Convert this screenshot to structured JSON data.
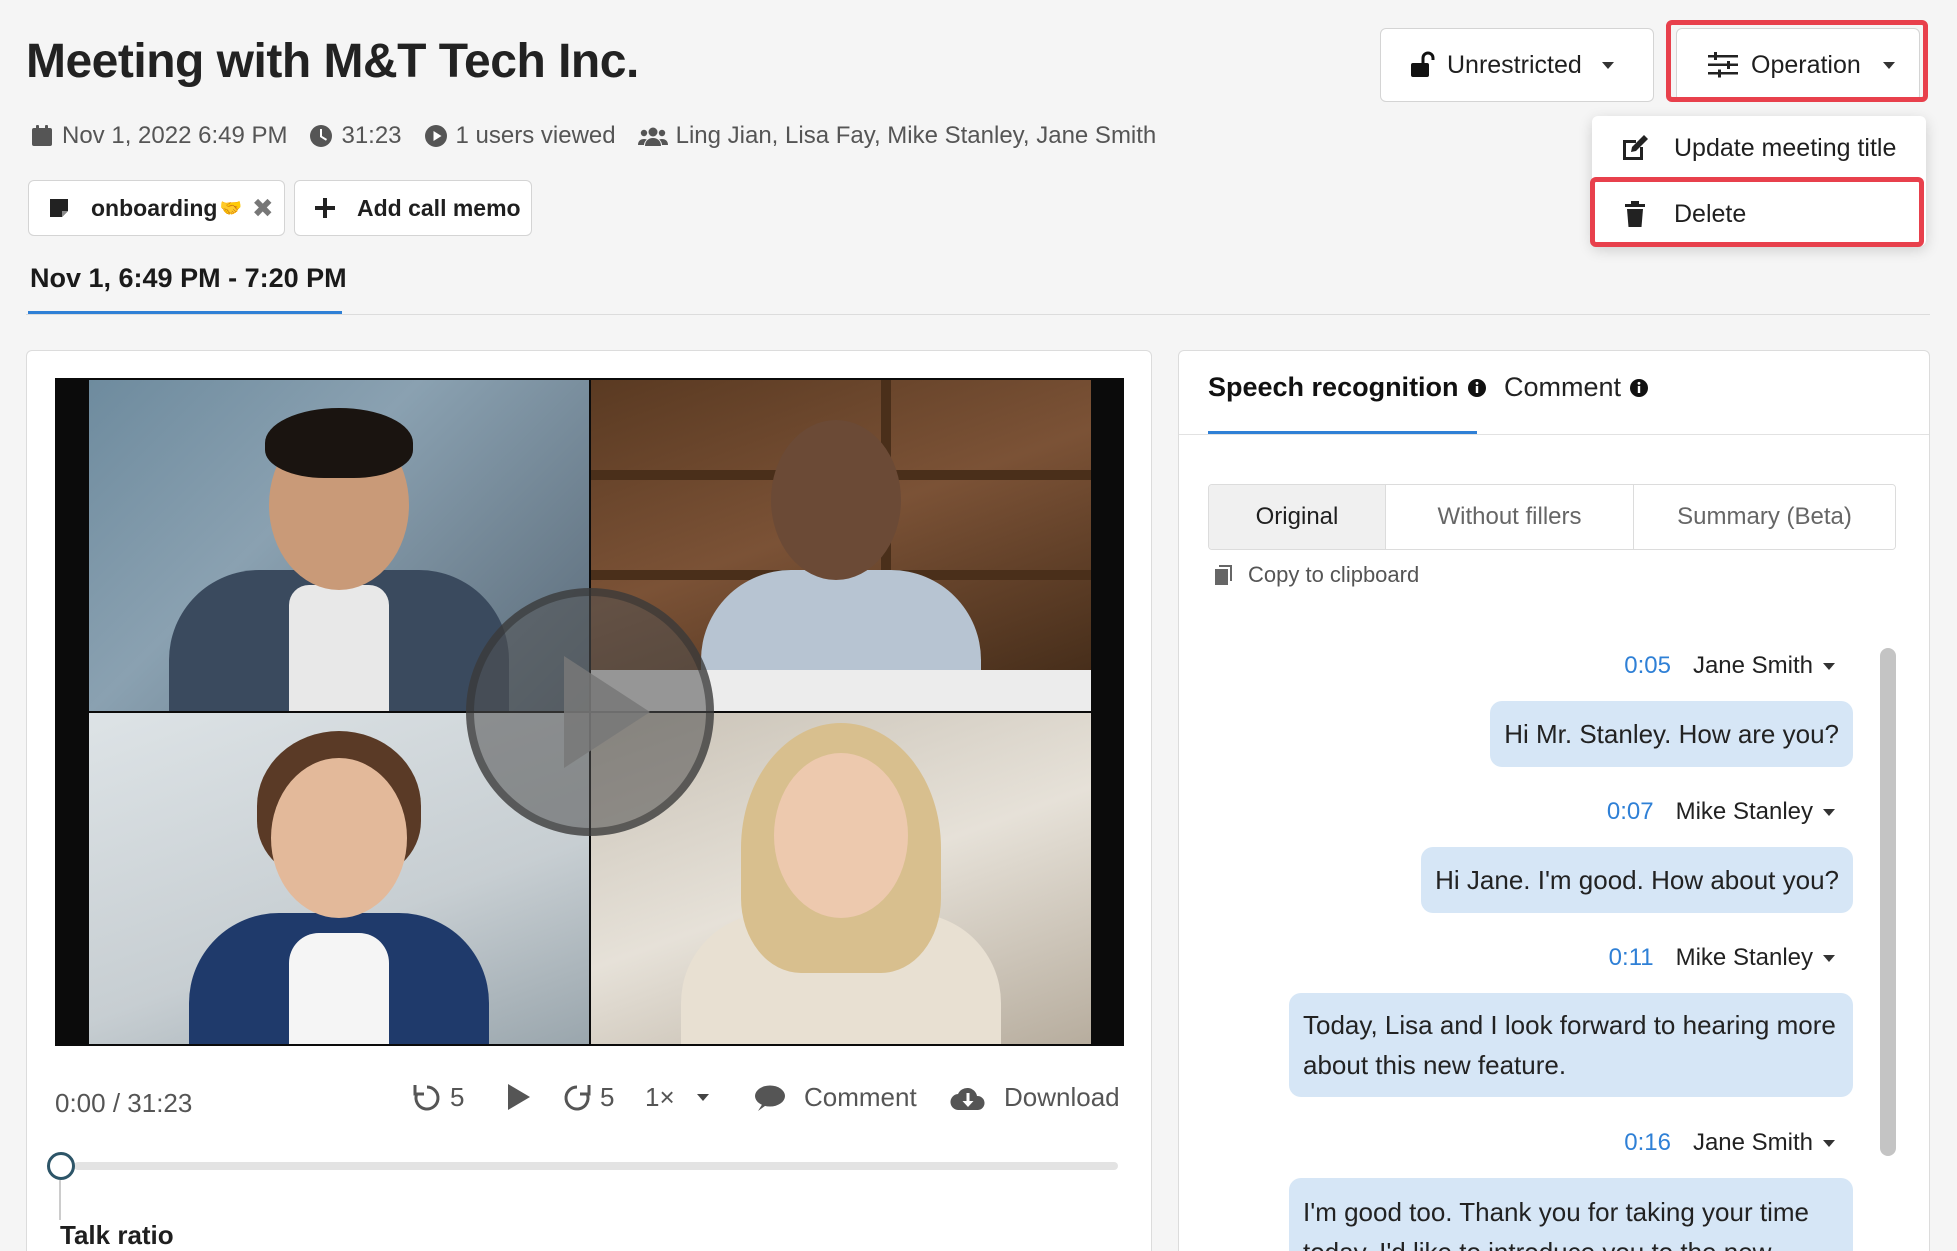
{
  "header": {
    "title": "Meeting with M&T Tech Inc.",
    "date": "Nov 1, 2022 6:49 PM",
    "duration": "31:23",
    "views": "1 users viewed",
    "participants": "Ling Jian, Lisa Fay, Mike Stanley, Jane Smith"
  },
  "tags": {
    "tag_label": "onboarding",
    "tag_emoji": "🤝",
    "remove_symbol": "✖",
    "add_memo_label": "Add call memo"
  },
  "session_range": "Nov 1, 6:49 PM - 7:20 PM",
  "toolbar": {
    "visibility_label": "Unrestricted",
    "operation_label": "Operation"
  },
  "operation_menu": {
    "items": [
      {
        "label": "Update meeting title",
        "icon": "edit-icon"
      },
      {
        "label": "Delete",
        "icon": "trash-icon"
      }
    ]
  },
  "player": {
    "time_display": "0:00 / 31:23",
    "rewind_seconds": "5",
    "forward_seconds": "5",
    "speed": "1×",
    "comment_label": "Comment",
    "download_label": "Download",
    "progress": 0
  },
  "talk_ratio_label": "Talk ratio",
  "transcript": {
    "tabs": [
      "Speech recognition",
      "Comment"
    ],
    "views": [
      "Original",
      "Without fillers",
      "Summary (Beta)"
    ],
    "selected_view": "Original",
    "copy_label": "Copy to clipboard",
    "messages": [
      {
        "time": "0:05",
        "speaker": "Jane Smith",
        "text": "Hi Mr. Stanley. How are you?"
      },
      {
        "time": "0:07",
        "speaker": "Mike Stanley",
        "text": "Hi Jane. I'm good. How about you?"
      },
      {
        "time": "0:11",
        "speaker": "Mike Stanley",
        "text": "Today, Lisa and I look forward to hearing more about this new feature."
      },
      {
        "time": "0:16",
        "speaker": "Jane Smith",
        "text": "I'm good too. Thank you for taking your time today. I'd like to introduce you to the new"
      }
    ]
  },
  "colors": {
    "accent": "#2f80d6",
    "highlight": "#e8404c",
    "bubble": "#d6e6f6"
  }
}
